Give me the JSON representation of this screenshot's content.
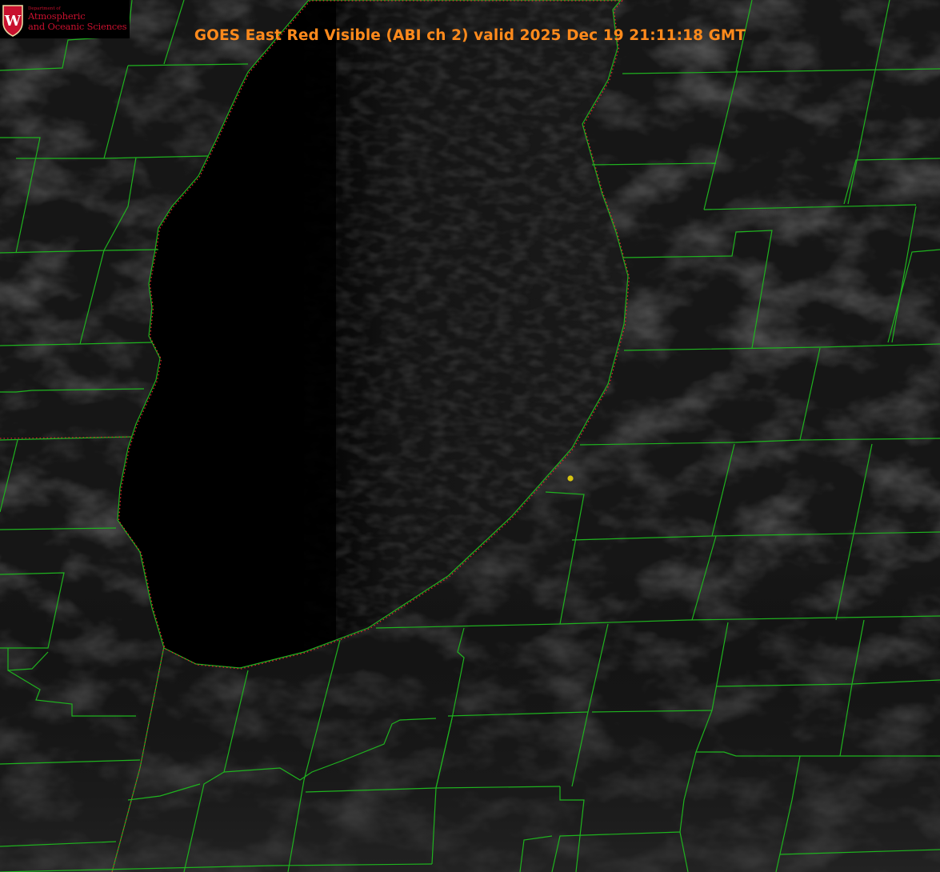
{
  "title": "GOES East Red Visible (ABI ch 2) valid 2025 Dec 19 21:11:18 GMT",
  "logo": {
    "department": "Department of",
    "line1": "Atmospheric",
    "line2": "and Oceanic Sciences",
    "emblem_letter": "W"
  },
  "colors": {
    "title": "#ff8a1c",
    "county_lines": "#1fb31f",
    "shoreline_dotted": "#e0242a",
    "marker": "#d7c410",
    "logo_red": "#c8102e"
  }
}
